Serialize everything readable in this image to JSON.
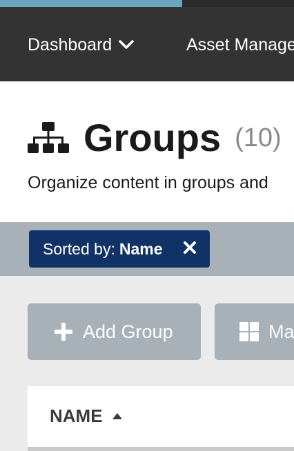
{
  "nav": {
    "items": [
      {
        "label": "Dashboard",
        "icon": "chevron-down-icon"
      },
      {
        "label": "Asset Manage"
      }
    ]
  },
  "header": {
    "icon": "tree-icon",
    "title": "Groups",
    "count": "(10)",
    "description": "Organize content in groups and"
  },
  "sort": {
    "label": "Sorted by:",
    "value": "Name",
    "icon": "close-icon"
  },
  "toolbar": {
    "add_label": "Add Group",
    "add_icon": "plus-icon",
    "manage_label": "Ma",
    "manage_icon": "grid-icon"
  },
  "table": {
    "columns": [
      {
        "label": "NAME",
        "sort": "ascending"
      }
    ]
  },
  "colors": {
    "accent": "#6aa7bd",
    "nav_bg": "#333333",
    "chip_bg": "#113266",
    "button_bg": "#a8b0b8"
  }
}
